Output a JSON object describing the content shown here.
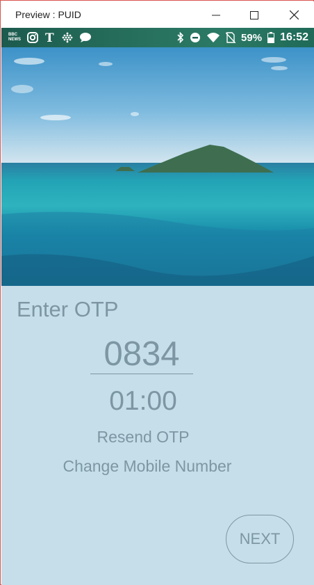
{
  "window": {
    "title": "Preview : PUID",
    "border_color": "#d9534f"
  },
  "statusbar": {
    "left_icons": [
      "bbc-news-icon",
      "instagram-icon",
      "nytimes-icon",
      "dots-grid-icon",
      "chat-bubble-icon"
    ],
    "right_icons": [
      "bluetooth-icon",
      "do-not-disturb-icon",
      "wifi-icon",
      "no-sim-icon",
      "battery-icon"
    ],
    "battery": "59%",
    "time": "16:52",
    "bbc_top": "BBC",
    "bbc_bottom": "NEWS"
  },
  "screen": {
    "heading": "Enter OTP",
    "otp_value": "0834",
    "timer": "01:00",
    "resend_label": "Resend OTP",
    "change_mobile_label": "Change Mobile Number",
    "next_label": "NEXT",
    "accent_color": "#7d96a3",
    "background_color": "#c6dee9"
  }
}
